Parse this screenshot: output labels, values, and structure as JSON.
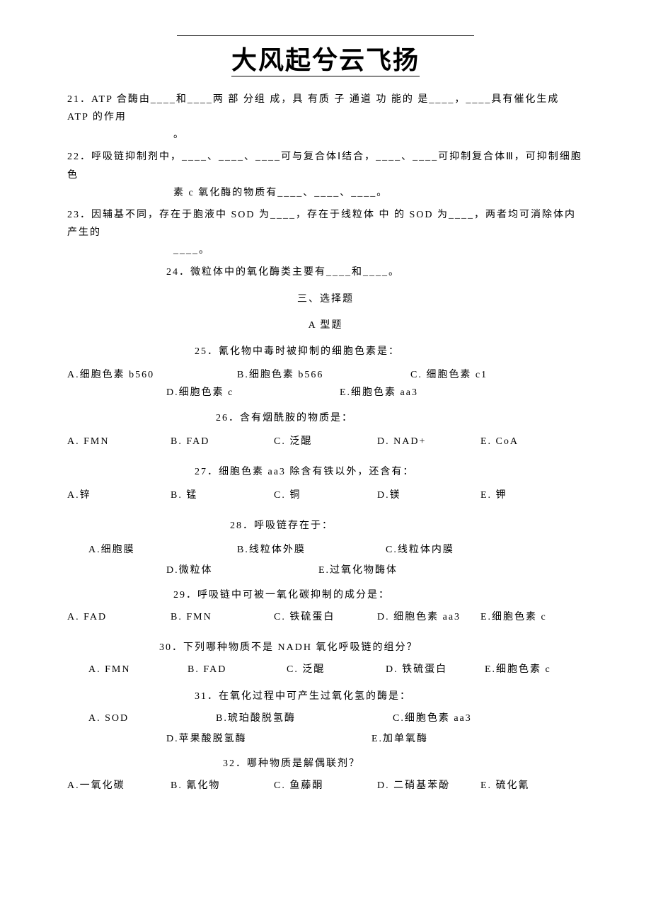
{
  "header": {
    "calligraphy": "大风起兮云飞扬"
  },
  "questions": {
    "q21": {
      "line1": "21．ATP 合酶由____和____两 部 分组 成，具 有质 子 通道 功 能的 是____，____具有催化生成 ATP 的作用",
      "line2": "。"
    },
    "q22": {
      "line1": "22．呼吸链抑制剂中，____、____、____可与复合体Ⅰ结合，____、____可抑制复合体Ⅲ，可抑制细胞色",
      "line2": "素 c 氧化酶的物质有____、____、____。"
    },
    "q23": {
      "line1": "23．因辅基不同，存在于胞液中 SOD 为____，存在于线粒体 中 的 SOD 为____，两者均可消除体内产生的",
      "line2": "____。"
    },
    "q24": "24．微粒体中的氧化酶类主要有____和____。"
  },
  "section3": {
    "title": "三、选择题",
    "subtype": "A 型题"
  },
  "mcq": {
    "q25": {
      "stem": "25．氰化物中毒时被抑制的细胞色素是：",
      "A": "A.细胞色素 b560",
      "B": "B.细胞色素 b566",
      "C": "C. 细胞色素 c1",
      "D": "D.细胞色素 c",
      "E": "E.细胞色素 aa3"
    },
    "q26": {
      "stem": "26．含有烟酰胺的物质是：",
      "A": "A. FMN",
      "B": "B. FAD",
      "C": "C. 泛醌",
      "D": "D. NAD+",
      "E": "E. CoA"
    },
    "q27": {
      "stem": "27．细胞色素 aa3 除含有铁以外，还含有：",
      "A": "A.锌",
      "B": "B. 锰",
      "C": "C. 铜",
      "D": "D.镁",
      "E": "E. 钾"
    },
    "q28": {
      "stem": "28．呼吸链存在于：",
      "A": "A.细胞膜",
      "B": "B.线粒体外膜",
      "C": "C.线粒体内膜",
      "D": "D.微粒体",
      "E": "E.过氧化物酶体"
    },
    "q29": {
      "stem": "29．呼吸链中可被一氧化碳抑制的成分是：",
      "A": "A. FAD",
      "B": "B. FMN",
      "C": "C. 铁硫蛋白",
      "D": "D. 细胞色素 aa3",
      "E": "E.细胞色素 c"
    },
    "q30": {
      "stem": "30．下列哪种物质不是 NADH 氧化呼吸链的组分？",
      "A": "A. FMN",
      "B": "B. FAD",
      "C": "C. 泛醌",
      "D": "D. 铁硫蛋白",
      "E": "E.细胞色素 c"
    },
    "q31": {
      "stem": "31．在氧化过程中可产生过氧化氢的酶是：",
      "A": "A. SOD",
      "B": "B.琥珀酸脱氢酶",
      "C": "C.细胞色素 aa3",
      "D": "D.苹果酸脱氢酶",
      "E": "E.加单氧酶"
    },
    "q32": {
      "stem": "32．哪种物质是解偶联剂？",
      "A": "A.一氧化碳",
      "B": "B. 氰化物",
      "C": "C. 鱼藤酮",
      "D": "D. 二硝基苯酚",
      "E": "E. 硫化氰"
    }
  }
}
